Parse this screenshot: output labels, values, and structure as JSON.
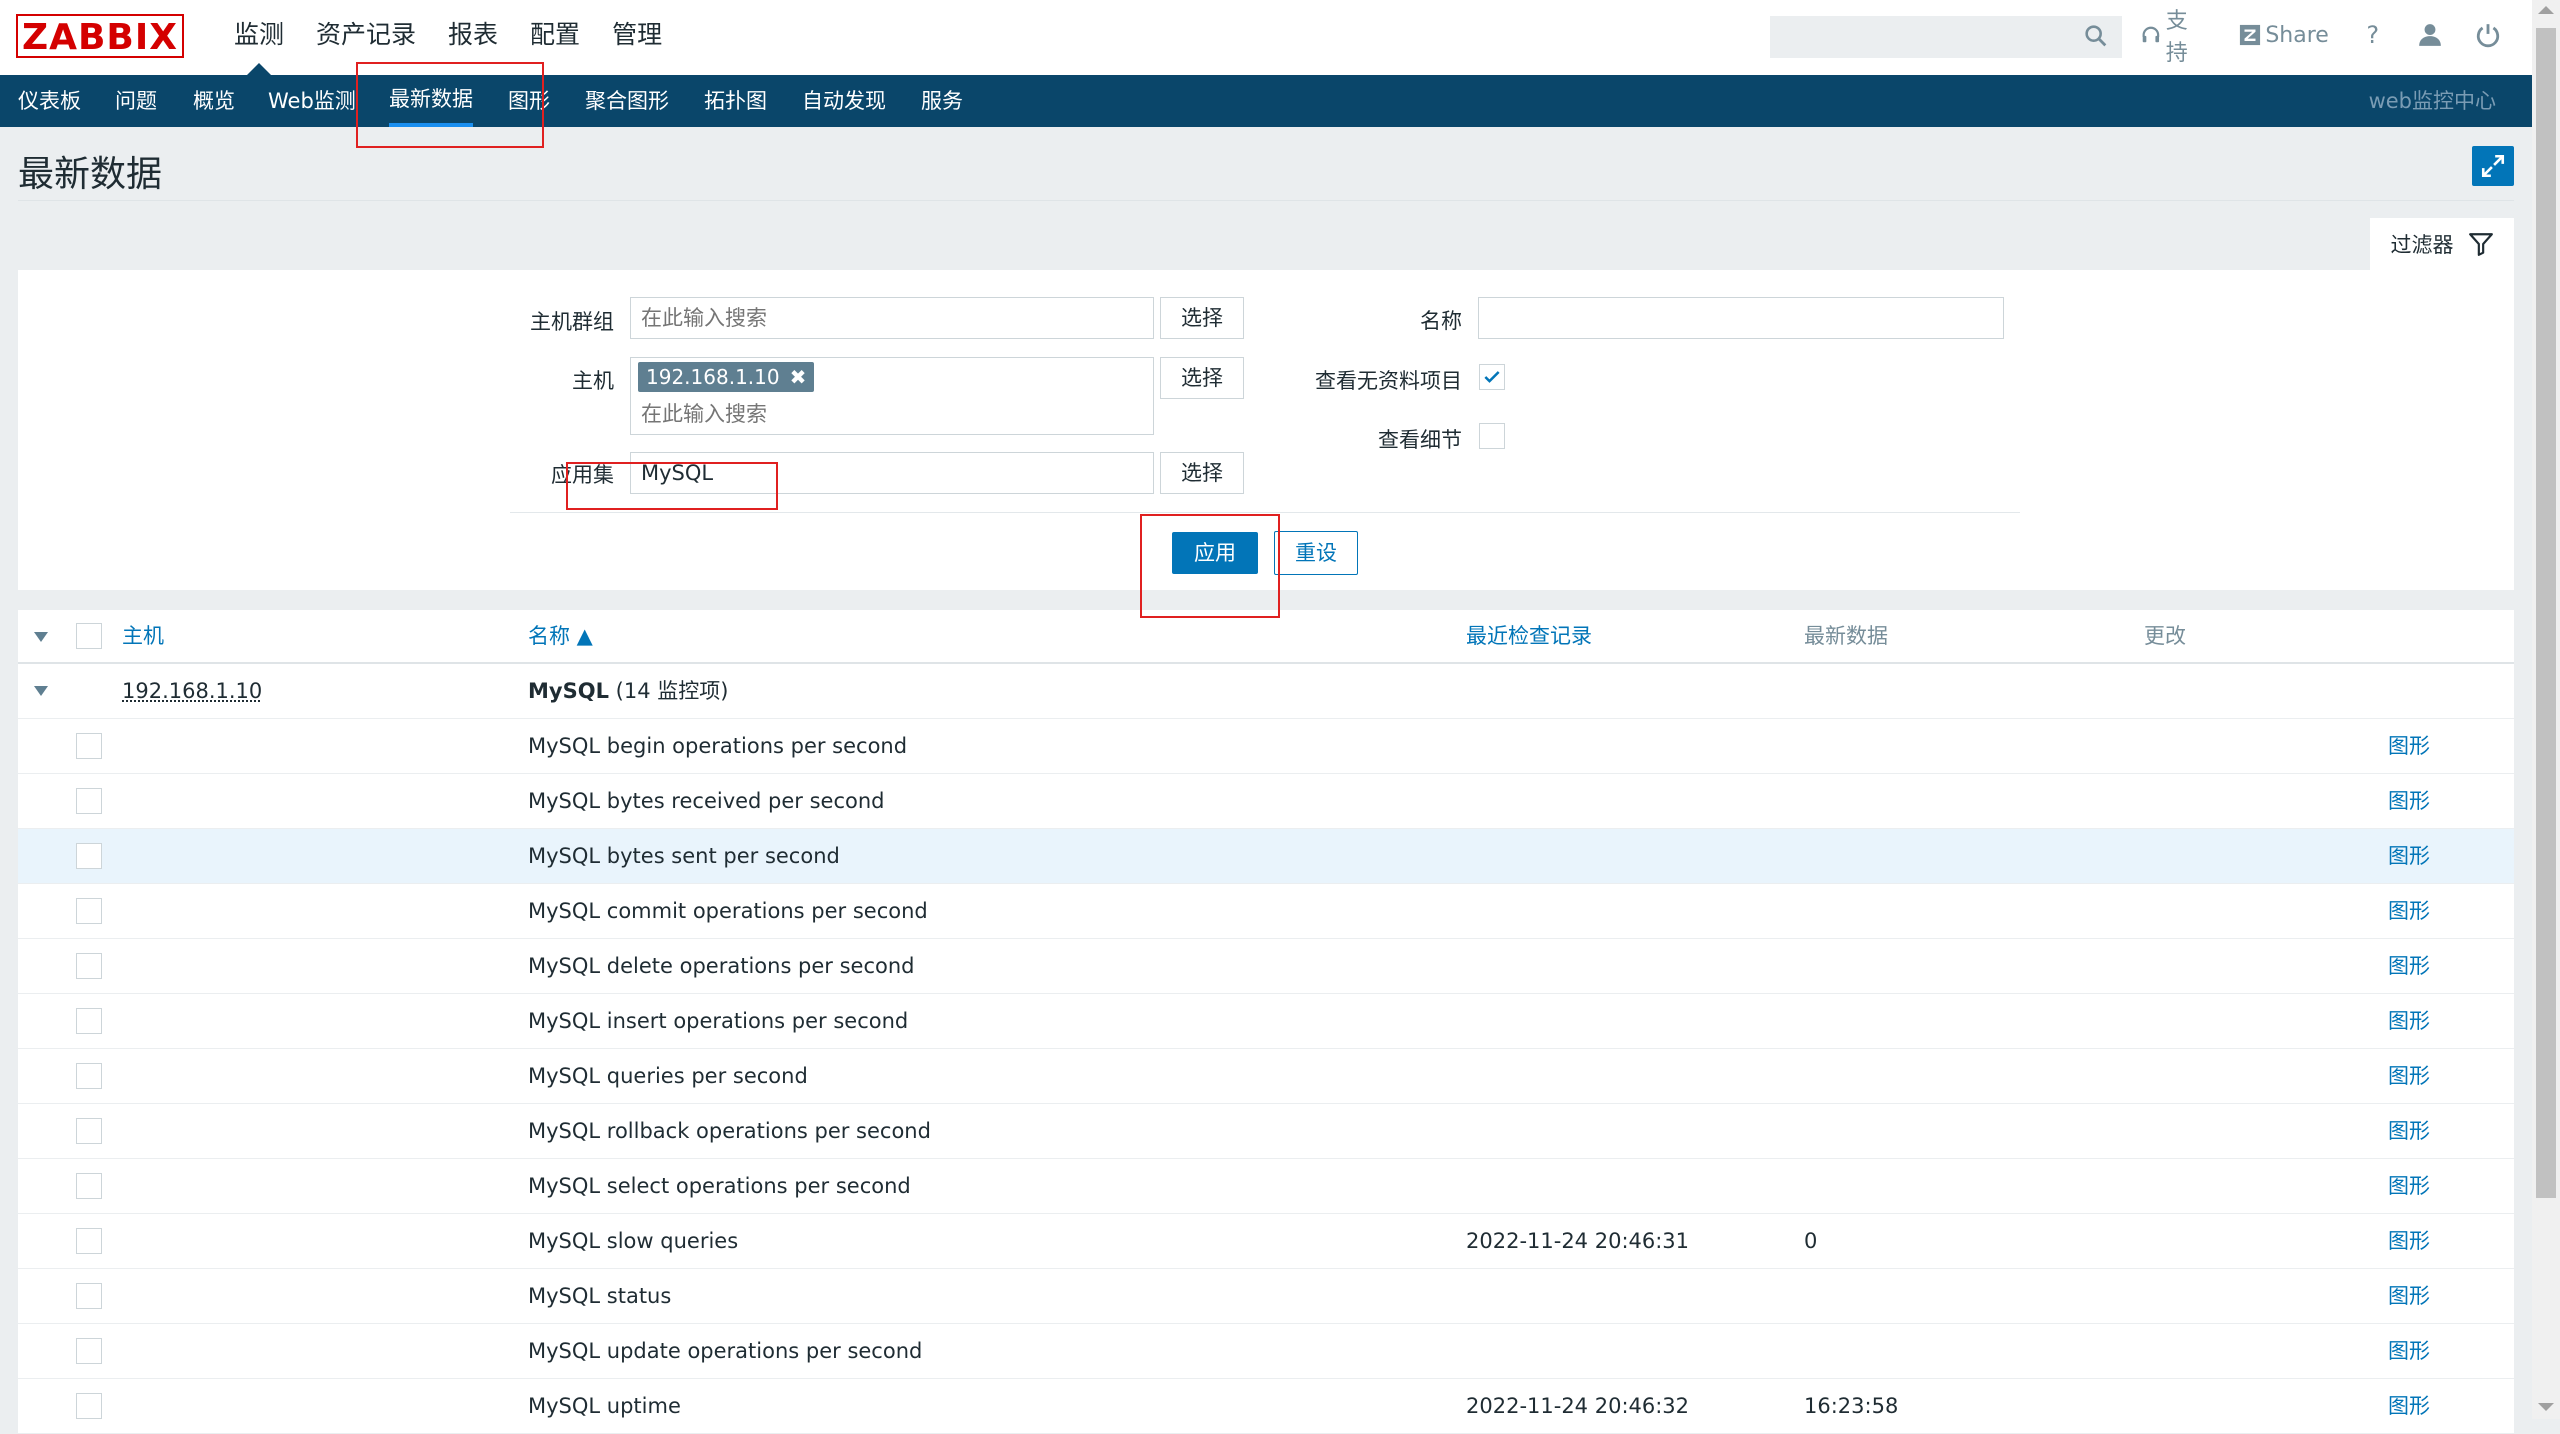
{
  "logo": "ZABBIX",
  "main_menu": [
    "监测",
    "资产记录",
    "报表",
    "配置",
    "管理"
  ],
  "header": {
    "search_placeholder": "",
    "support": "支持",
    "share": "Share",
    "help": "?"
  },
  "sub_nav": {
    "items": [
      "仪表板",
      "问题",
      "概览",
      "Web监测",
      "最新数据",
      "图形",
      "聚合图形",
      "拓扑图",
      "自动发现",
      "服务"
    ],
    "active": "最新数据",
    "right": "web监控中心"
  },
  "page_title": "最新数据",
  "filter": {
    "tab_label": "过滤器",
    "host_group_label": "主机群组",
    "host_group_placeholder": "在此输入搜索",
    "host_label": "主机",
    "host_tag": "192.168.1.10",
    "host_placeholder": "在此输入搜索",
    "application_label": "应用集",
    "application_value": "MySQL",
    "select_label": "选择",
    "name_label": "名称",
    "name_value": "",
    "show_without_data_label": "查看无资料项目",
    "show_without_data_checked": true,
    "show_details_label": "查看细节",
    "show_details_checked": false,
    "apply_label": "应用",
    "reset_label": "重设"
  },
  "table": {
    "headers": {
      "host": "主机",
      "name": "名称 ▲",
      "last_check": "最近检查记录",
      "last_value": "最新数据",
      "change": "更改"
    },
    "group": {
      "host": "192.168.1.10",
      "app_name": "MySQL",
      "app_count": "(14 监控项)"
    },
    "rows": [
      {
        "name": "MySQL begin operations per second",
        "last_check": "",
        "last_value": "",
        "link": "图形"
      },
      {
        "name": "MySQL bytes received per second",
        "last_check": "",
        "last_value": "",
        "link": "图形"
      },
      {
        "name": "MySQL bytes sent per second",
        "last_check": "",
        "last_value": "",
        "link": "图形"
      },
      {
        "name": "MySQL commit operations per second",
        "last_check": "",
        "last_value": "",
        "link": "图形"
      },
      {
        "name": "MySQL delete operations per second",
        "last_check": "",
        "last_value": "",
        "link": "图形"
      },
      {
        "name": "MySQL insert operations per second",
        "last_check": "",
        "last_value": "",
        "link": "图形"
      },
      {
        "name": "MySQL queries per second",
        "last_check": "",
        "last_value": "",
        "link": "图形"
      },
      {
        "name": "MySQL rollback operations per second",
        "last_check": "",
        "last_value": "",
        "link": "图形"
      },
      {
        "name": "MySQL select operations per second",
        "last_check": "",
        "last_value": "",
        "link": "图形"
      },
      {
        "name": "MySQL slow queries",
        "last_check": "2022-11-24 20:46:31",
        "last_value": "0",
        "link": "图形"
      },
      {
        "name": "MySQL status",
        "last_check": "",
        "last_value": "",
        "link": "图形"
      },
      {
        "name": "MySQL update operations per second",
        "last_check": "",
        "last_value": "",
        "link": "图形"
      },
      {
        "name": "MySQL uptime",
        "last_check": "2022-11-24 20:46:32",
        "last_value": "16:23:58",
        "link": "图形"
      }
    ]
  },
  "colors": {
    "brand": "#d40000",
    "nav_bg": "#0a466a",
    "primary": "#0275b8",
    "annotation": "#e02020"
  }
}
